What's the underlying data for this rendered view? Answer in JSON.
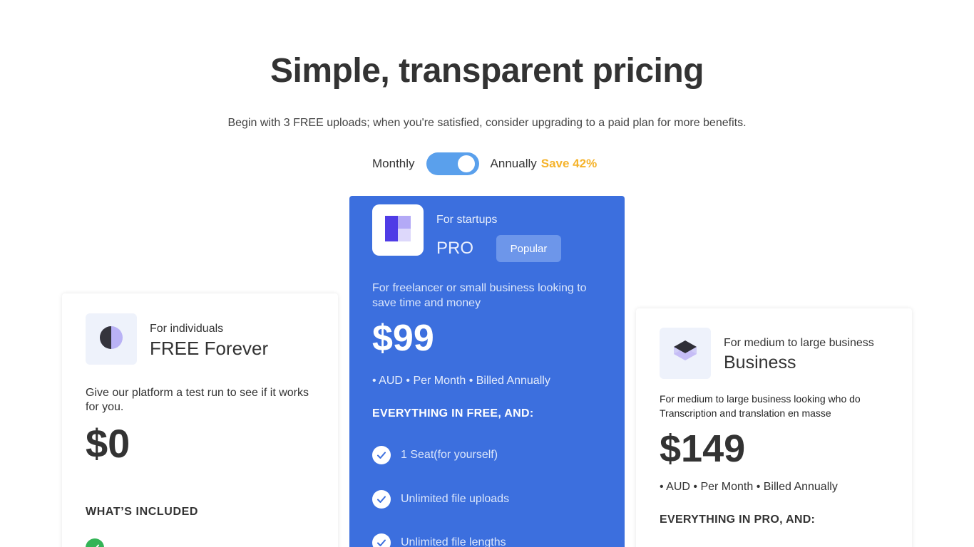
{
  "header": {
    "title": "Simple, transparent pricing",
    "subtitle": "Begin with 3 FREE uploads; when you're satisfied, consider upgrading to a paid plan for more benefits."
  },
  "billing": {
    "monthly_label": "Monthly",
    "annually_label": "Annually",
    "save_label": "Save 42%",
    "selected": "Annually"
  },
  "plans": [
    {
      "audience": "For individuals",
      "name": "FREE Forever",
      "description": "Give our platform a test run to see if it works for you.",
      "price": "$0",
      "features_heading": "WHAT’S INCLUDED",
      "icon": "half-circle-icon"
    },
    {
      "audience": "For startups",
      "name": "PRO",
      "badge": "Popular",
      "description": "For freelancer or small business looking to save time and money",
      "price": "$99",
      "billing_note": "• AUD • Per Month • Billed Annually",
      "features_heading": "EVERYTHING IN FREE, AND:",
      "features": [
        "1 Seat(for yourself)",
        "Unlimited file uploads",
        "Unlimited file lengths"
      ],
      "icon": "blocks-icon"
    },
    {
      "audience": "For medium to large business",
      "name": "Business",
      "description": "For medium to large business looking who do Transcription and translation en masse",
      "price": "$149",
      "billing_note": "• AUD • Per Month • Billed Annually",
      "features_heading": "EVERYTHING IN PRO, AND:",
      "icon": "stack-icon"
    }
  ],
  "colors": {
    "pro_card": "#3c6fde",
    "toggle": "#5aa0ec",
    "save_accent": "#f5b32b",
    "check_green": "#34b457"
  }
}
